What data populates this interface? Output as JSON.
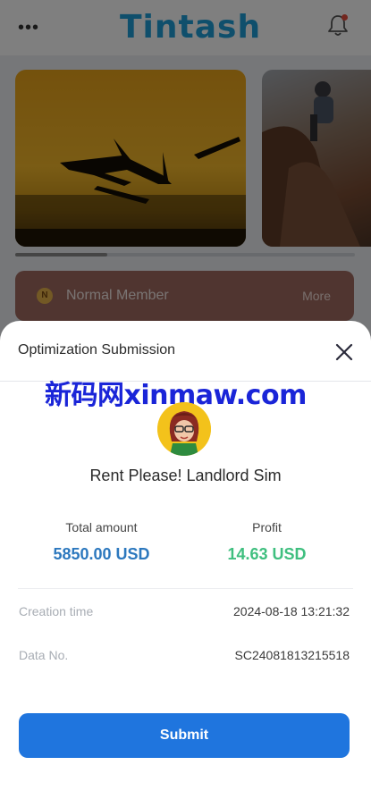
{
  "app": {
    "menu_icon": "more-dots-icon",
    "brand": "Tintash",
    "notification_icon": "bell-icon"
  },
  "banners": [
    {
      "name": "airplane-sunset"
    },
    {
      "name": "rock-climbers"
    }
  ],
  "banner_progress": 0.27,
  "member": {
    "badge": "N",
    "label": "Normal Member",
    "more": "More"
  },
  "sheet": {
    "title": "Optimization Submission",
    "close_icon": "close-icon",
    "watermark": "新码网xinmaw.com",
    "avatar_icon": "game-avatar-icon",
    "game_name": "Rent Please! Landlord Sim",
    "stats": {
      "total_label": "Total amount",
      "total_value": "5850.00 USD",
      "profit_label": "Profit",
      "profit_value": "14.63 USD"
    },
    "rows": [
      {
        "key": "Creation time",
        "value": "2024-08-18 13:21:32"
      },
      {
        "key": "Data No.",
        "value": "SC24081813215518"
      }
    ],
    "submit_label": "Submit"
  },
  "colors": {
    "brand": "#1e9ed8",
    "total": "#2c78be",
    "profit": "#3fbf7f",
    "button": "#1f75de"
  }
}
